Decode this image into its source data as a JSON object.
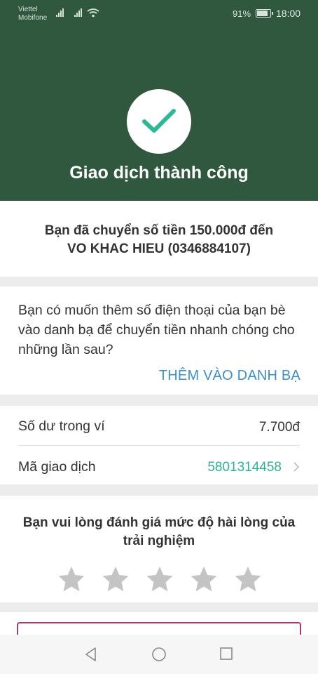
{
  "status_bar": {
    "carrier_1": "Viettel",
    "carrier_2": "Mobifone",
    "battery_percent": "91%",
    "battery_level": 0.91,
    "time": "18:00"
  },
  "header": {
    "icon": "checkmark-icon",
    "title": "Giao dịch thành công",
    "background_color": "#30583f",
    "accent_color": "#2fb897"
  },
  "transfer": {
    "message_line1": "Bạn đã chuyển số tiền 150.000đ đến",
    "message_line2": "VO KHAC HIEU (0346884107)"
  },
  "contacts": {
    "question": "Bạn có muốn thêm số điện thoại của bạn bè vào danh bạ để chuyển tiền nhanh chóng cho những lần sau?",
    "add_button": "THÊM VÀO DANH BẠ",
    "add_button_color": "#3a8fcd"
  },
  "details": {
    "balance_label": "Số dư trong ví",
    "balance_value": "7.700đ",
    "transaction_label": "Mã giao dịch",
    "transaction_value": "5801314458"
  },
  "rating": {
    "question": "Bạn vui lòng đánh giá mức độ hài lòng của trải nghiệm",
    "max_stars": 5,
    "selected_stars": 0
  },
  "nav": {
    "back_icon": "back-triangle-icon",
    "home_icon": "home-circle-icon",
    "recents_icon": "recents-square-icon"
  }
}
